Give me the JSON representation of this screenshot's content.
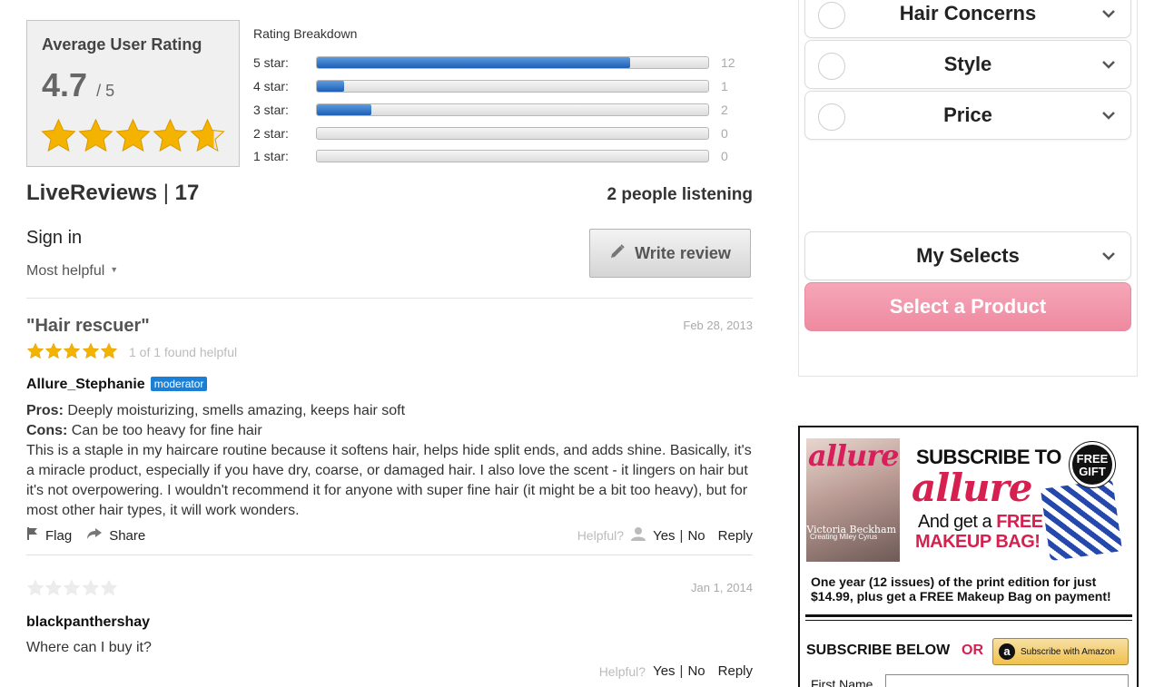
{
  "rating_summary": {
    "title": "Average User Rating",
    "score": "4.7",
    "out_of": "/ 5",
    "stars_value": 4.7,
    "star_color": "#f5b301"
  },
  "breakdown": {
    "title": "Rating Breakdown",
    "rows": [
      {
        "label": "5 star:",
        "count": "12",
        "fraction": 0.8
      },
      {
        "label": "4 star:",
        "count": "1",
        "fraction": 0.07
      },
      {
        "label": "3 star:",
        "count": "2",
        "fraction": 0.14
      },
      {
        "label": "2 star:",
        "count": "0",
        "fraction": 0
      },
      {
        "label": "1 star:",
        "count": "0",
        "fraction": 0
      }
    ],
    "fill_color": "#2a6fc9"
  },
  "livereviews": {
    "brand": "LiveReviews",
    "separator": "|",
    "count": "17",
    "listening": "2 people listening",
    "sign_in": "Sign in",
    "sort_label": "Most helpful",
    "write_review": "Write review"
  },
  "reviews": [
    {
      "title": "\"Hair rescuer\"",
      "date": "Feb 28, 2013",
      "stars": 5,
      "helpful_count": "1 of 1 found helpful",
      "author": "Allure_Stephanie",
      "badge": "moderator",
      "pros_label": "Pros:",
      "pros": "Deeply moisturizing, smells amazing, keeps hair soft",
      "cons_label": "Cons:",
      "cons": "Can be too heavy for fine hair",
      "body": "This is a staple in my haircare routine because it softens hair, helps hide split ends, and adds shine. Basically, it's a miracle product, especially if you have dry, coarse, or damaged hair. I also love the scent - it lingers on hair but it's not overpowering. I wouldn't recommend it for anyone with super fine hair (it might be a bit too heavy), but for most other hair types, it will work wonders.",
      "flag": "Flag",
      "share": "Share",
      "helpful_q": "Helpful?",
      "yes": "Yes",
      "no": "No",
      "reply": "Reply"
    },
    {
      "title": "",
      "date": "Jan 1, 2014",
      "stars": 0,
      "author": "blackpanthershay",
      "body": "Where can I buy it?",
      "helpful_q": "Helpful?",
      "yes": "Yes",
      "no": "No",
      "reply": "Reply"
    }
  ],
  "filters": {
    "items": [
      {
        "label": "Hair Concerns"
      },
      {
        "label": "Style"
      },
      {
        "label": "Price"
      }
    ],
    "my_selects": "My Selects",
    "select_product": "Select a Product"
  },
  "ad": {
    "cover_logo": "allure",
    "cover_line1": "Creating Miley Cyrus",
    "cover_line2": "Victoria Beckham",
    "subscribe_to": "SUBSCRIBE TO",
    "logo": "allure",
    "get_a": "And get a",
    "free": "FREE",
    "makeup_bag": "MAKEUP BAG!",
    "gift_badge_l1": "FREE",
    "gift_badge_l2": "GIFT",
    "description": "One year (12 issues) of the print edition for just $14.99, plus get a FREE Makeup Bag on payment!",
    "subscribe_below": "SUBSCRIBE BELOW",
    "or": "OR",
    "amazon_btn": "Subscribe with Amazon",
    "first_name": "First Name",
    "brand_color": "#d6204f"
  }
}
